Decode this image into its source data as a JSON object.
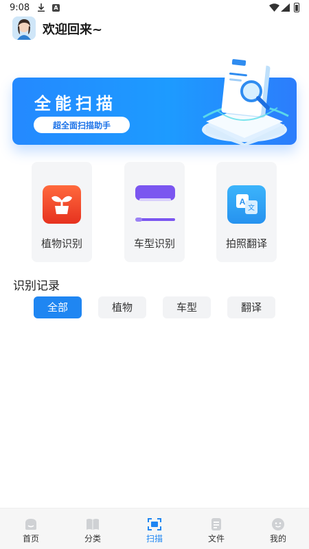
{
  "status_bar": {
    "time": "9:08",
    "icons": [
      "download-icon",
      "a-icon",
      "wifi-icon",
      "signal-icon",
      "battery-icon"
    ]
  },
  "header": {
    "welcome": "欢迎回来~",
    "avatar_icon": "avatar-icon"
  },
  "banner": {
    "title": "全能扫描",
    "subtitle": "超全面扫描助手",
    "art_icon": "document-scan-icon"
  },
  "features": [
    {
      "label": "植物识别",
      "icon": "plant-icon",
      "color": "#f0492a"
    },
    {
      "label": "车型识别",
      "icon": "car-icon",
      "color": "#7b56f0"
    },
    {
      "label": "拍照翻译",
      "icon": "translate-icon",
      "color": "#2fa6f5"
    }
  ],
  "records": {
    "title": "识别记录",
    "tabs": [
      {
        "label": "全部",
        "active": true
      },
      {
        "label": "植物",
        "active": false
      },
      {
        "label": "车型",
        "active": false
      },
      {
        "label": "翻译",
        "active": false
      }
    ]
  },
  "nav": {
    "items": [
      {
        "label": "首页",
        "icon": "home-icon",
        "active": false
      },
      {
        "label": "分类",
        "icon": "book-icon",
        "active": false
      },
      {
        "label": "扫描",
        "icon": "scan-icon",
        "active": true
      },
      {
        "label": "文件",
        "icon": "file-icon",
        "active": false
      },
      {
        "label": "我的",
        "icon": "profile-icon",
        "active": false
      }
    ]
  },
  "colors": {
    "accent": "#1f86f2",
    "banner_start": "#2489ff",
    "banner_end": "#2c7dfc",
    "card_bg": "#f4f5f7"
  }
}
